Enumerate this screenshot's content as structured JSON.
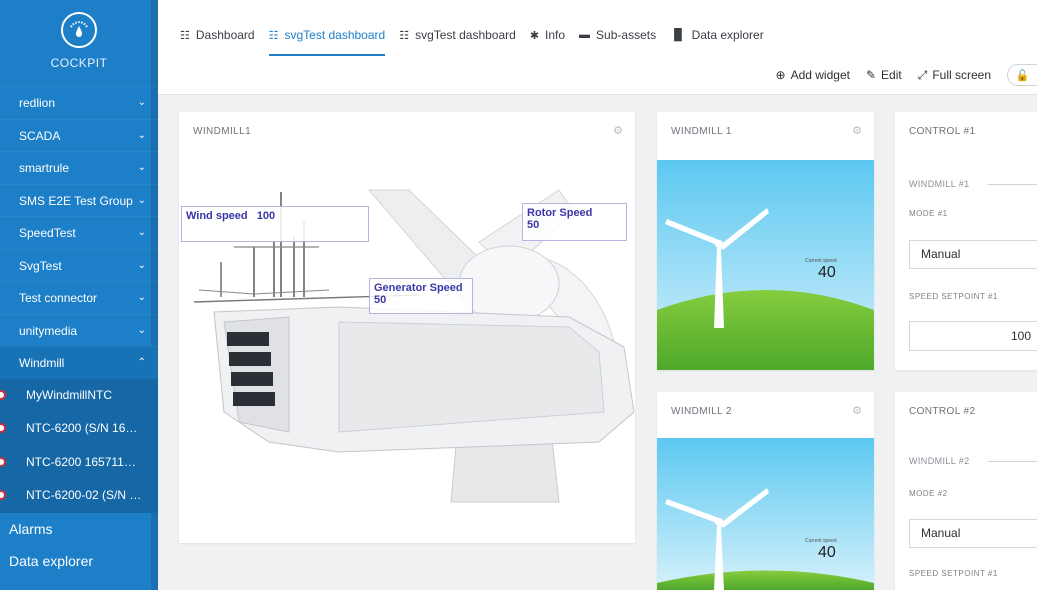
{
  "app": {
    "name": "COCKPIT"
  },
  "sidebar": {
    "groups": [
      {
        "label": "redlion",
        "chevron": "chevron-down-icon"
      },
      {
        "label": "SCADA",
        "chevron": "chevron-down-icon"
      },
      {
        "label": "smartrule",
        "chevron": "chevron-down-icon"
      },
      {
        "label": "SMS E2E Test Group",
        "chevron": "chevron-down-icon"
      },
      {
        "label": "SpeedTest",
        "chevron": "chevron-down-icon"
      },
      {
        "label": "SvgTest",
        "chevron": "chevron-down-icon"
      },
      {
        "label": "Test connector",
        "chevron": "chevron-down-icon"
      },
      {
        "label": "unitymedia",
        "chevron": "chevron-down-icon"
      },
      {
        "label": "Windmill",
        "chevron": "chevron-up-icon"
      }
    ],
    "windmill_children": [
      "MyWindmillNTC",
      "NTC-6200 (S/N 16…",
      "NTC-6200 165711…",
      "NTC-6200-02 (S/N …"
    ],
    "bottom_items": [
      "Alarms",
      "Data explorer"
    ]
  },
  "tabs": [
    {
      "label": "Dashboard",
      "icon": "grid-icon"
    },
    {
      "label": "svgTest dashboard",
      "icon": "grid-icon"
    },
    {
      "label": "svgTest dashboard",
      "icon": "grid-icon"
    },
    {
      "label": "Info",
      "icon": "asterisk-icon"
    },
    {
      "label": "Sub-assets",
      "icon": "folder-icon"
    },
    {
      "label": "Data explorer",
      "icon": "bar-chart-icon"
    }
  ],
  "actions": {
    "add_widget": "Add widget",
    "edit": "Edit",
    "full_screen": "Full screen"
  },
  "widgets": {
    "windmill_big": {
      "title": "WINDMILL1",
      "wind_speed_label": "Wind speed",
      "wind_speed_value": "100",
      "rotor_speed_label": "Rotor Speed",
      "rotor_speed_value": "50",
      "generator_speed_label": "Generator Speed",
      "generator_speed_value": "50"
    },
    "windmill_1": {
      "title": "WINDMILL 1",
      "speed_label": "Current speed",
      "speed_value": "40"
    },
    "windmill_2": {
      "title": "WINDMILL 2",
      "speed_label": "Current speed",
      "speed_value": "40"
    },
    "control_1": {
      "title": "CONTROL #1",
      "section": "WINDMILL #1",
      "mode_label": "MODE #1",
      "mode_value": "Manual",
      "setpoint_label": "SPEED SETPOINT #1",
      "setpoint_value": "100"
    },
    "control_2": {
      "title": "CONTROL #2",
      "section": "WINDMILL #2",
      "mode_label": "MODE #2",
      "mode_value": "Manual",
      "setpoint_label": "SPEED SETPOINT #1"
    }
  }
}
